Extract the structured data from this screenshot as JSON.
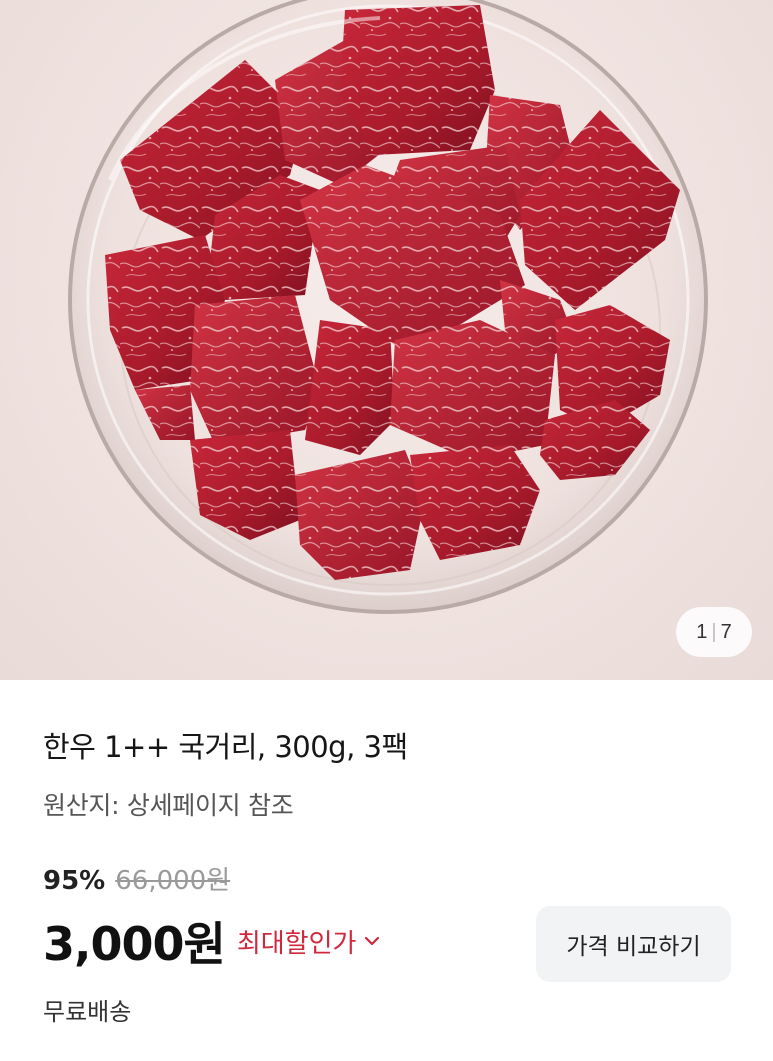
{
  "image": {
    "alt": "product-photo-beef-cubes-in-glass-bowl",
    "page_current": "1",
    "page_separator": "|",
    "page_total": "7"
  },
  "product": {
    "title": "한우 1++ 국거리, 300g, 3팩",
    "origin": "원산지: 상세페이지 참조",
    "discount_rate": "95%",
    "original_price": "66,000원",
    "sale_price": "3,000원",
    "max_discount_label": "최대할인가",
    "compare_button_label": "가격 비교하기",
    "shipping": "무료배송"
  },
  "colors": {
    "accent_red": "#d0283c",
    "button_bg": "#f2f3f5"
  },
  "icons": {
    "max_discount": "chevron-down-icon"
  }
}
